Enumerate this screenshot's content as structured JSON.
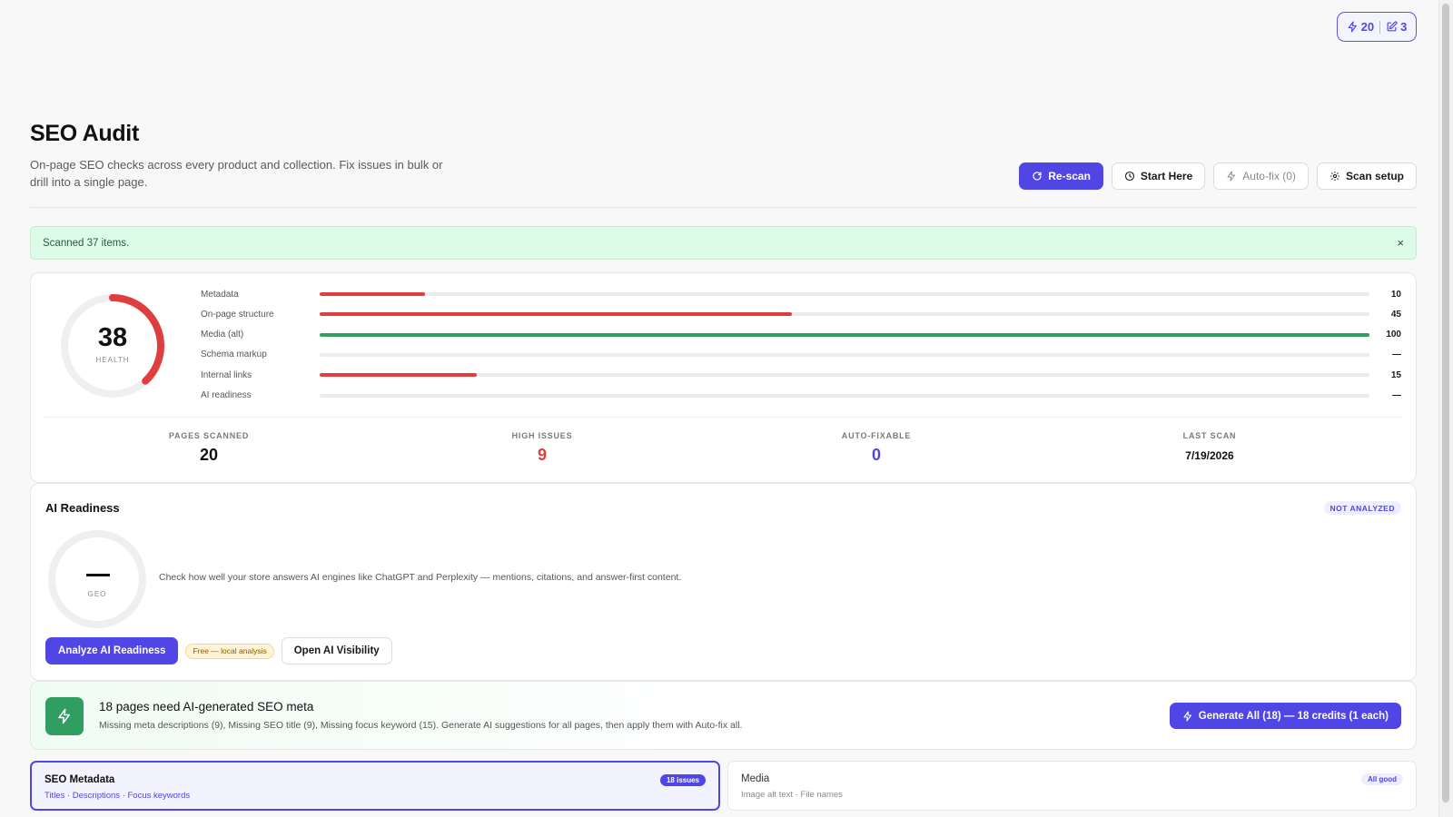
{
  "credits": {
    "ai_credits": "20",
    "edits": "3"
  },
  "header": {
    "title": "SEO Audit",
    "description": "On-page SEO checks across every product and collection. Fix issues in bulk or drill into a single page.",
    "actions": {
      "rescan": "Re-scan",
      "start_here": "Start Here",
      "autofix": "Auto-fix (0)",
      "scan_setup": "Scan setup"
    }
  },
  "alert": {
    "message": "Scanned 37 items.",
    "close": "×"
  },
  "health": {
    "score": "38",
    "score_value": 38,
    "label": "HEALTH",
    "metrics": [
      {
        "label": "Metadata",
        "value": "10",
        "percent": 10,
        "color": "#e03e3e"
      },
      {
        "label": "On-page structure",
        "value": "45",
        "percent": 45,
        "color": "#e03e3e"
      },
      {
        "label": "Media (alt)",
        "value": "100",
        "percent": 100,
        "color": "#2f9e60"
      },
      {
        "label": "Schema markup",
        "value": "—",
        "percent": 0,
        "color": "#e03e3e"
      },
      {
        "label": "Internal links",
        "value": "15",
        "percent": 15,
        "color": "#e03e3e"
      },
      {
        "label": "AI readiness",
        "value": "—",
        "percent": 0,
        "color": "#e03e3e"
      }
    ],
    "stats": [
      {
        "label": "PAGES SCANNED",
        "value": "20",
        "color": "#111111"
      },
      {
        "label": "HIGH ISSUES",
        "value": "9",
        "color": "#e03e3e"
      },
      {
        "label": "AUTO-FIXABLE",
        "value": "0",
        "color": "#4f46e5"
      },
      {
        "label": "LAST SCAN",
        "value": "7/19/2026",
        "color": "#111111"
      }
    ],
    "accent_red": "#e03e3e"
  },
  "ai_readiness": {
    "title": "AI Readiness",
    "status_badge": "NOT ANALYZED",
    "geo_value": "—",
    "geo_label": "GEO",
    "description": "Check how well your store answers AI engines like ChatGPT and Perplexity — mentions, citations, and answer-first content.",
    "analyze_button": "Analyze AI Readiness",
    "free_badge": "Free — local analysis",
    "open_visibility": "Open AI Visibility"
  },
  "meta_banner": {
    "title": "18 pages need AI-generated SEO meta",
    "subtitle": "Missing meta descriptions (9), Missing SEO title (9), Missing focus keyword (15). Generate AI suggestions for all pages, then apply them with Auto-fix all.",
    "button": "Generate All (18) — 18 credits (1 each)"
  },
  "tabs": [
    {
      "title": "SEO Metadata",
      "subtitle": "Titles · Descriptions · Focus keywords",
      "badge": "18 issues"
    },
    {
      "title": "Media",
      "subtitle": "Image alt text · File names",
      "badge": "All good"
    }
  ]
}
